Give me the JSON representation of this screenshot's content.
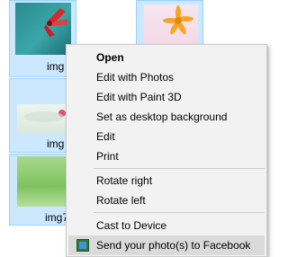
{
  "files": [
    {
      "label": "img"
    },
    {
      "label": ""
    },
    {
      "label": "img"
    },
    {
      "label": "img7"
    }
  ],
  "context_menu": {
    "items": [
      {
        "label": "Open",
        "bold": true
      },
      {
        "label": "Edit with Photos"
      },
      {
        "label": "Edit with Paint 3D"
      },
      {
        "label": "Set as desktop background"
      },
      {
        "label": "Edit"
      },
      {
        "label": "Print"
      },
      {
        "label": "Rotate right"
      },
      {
        "label": "Rotate left"
      },
      {
        "label": "Cast to Device"
      },
      {
        "label": "Send your photo(s) to Facebook",
        "icon": "facebook-share-icon",
        "highlighted": true
      }
    ]
  }
}
